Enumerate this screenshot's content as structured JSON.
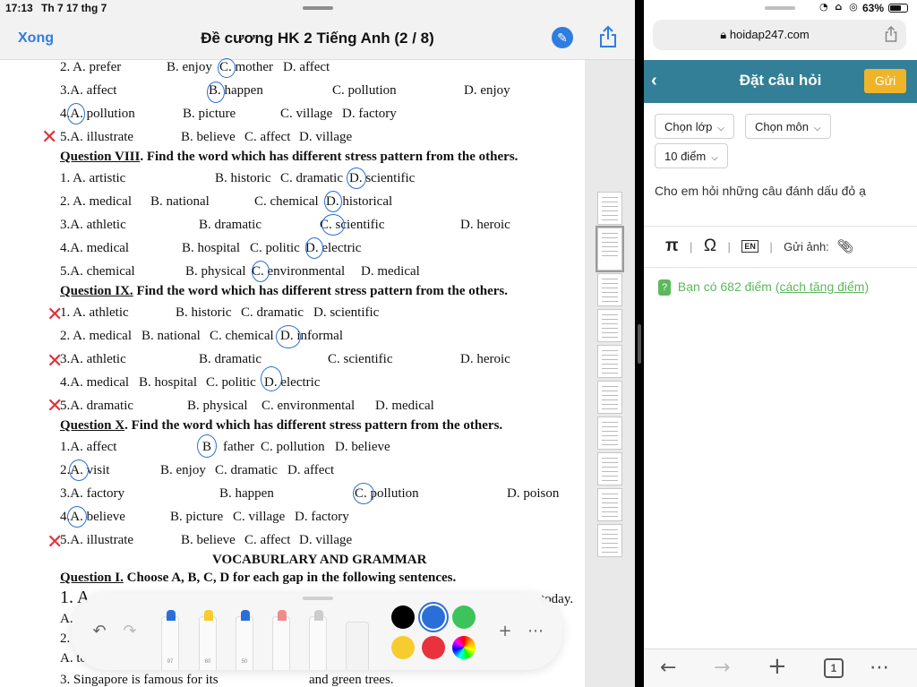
{
  "status": {
    "time": "17:13",
    "date": "Th 7 17 thg 7",
    "battery": "63%",
    "status_icons": "wifi-icon lock-icon location-icon"
  },
  "left_nav": {
    "done_label": "Xong",
    "title": "Đề cương HK 2 Tiếng Anh (2 / 8)",
    "markup_icon": "pen-markup-icon",
    "share_icon": "share-icon"
  },
  "doc": {
    "lines": [
      {
        "parts": [
          "2. A. prefer",
          "B. enjoy",
          "C. mother",
          "D. affect"
        ]
      },
      {
        "parts": [
          "3.A. affect",
          "B. happen",
          "C. pollution",
          "D. enjoy"
        ]
      },
      {
        "parts": [
          "4.A. pollution",
          "B. picture",
          "C. village",
          "D. factory"
        ]
      },
      {
        "parts": [
          "5.A. illustrate",
          "B. believe",
          "C. affect",
          "D. village"
        ]
      },
      {
        "q_label": "Question VIII",
        "q_text": ". Find the word which has different stress pattern from the others."
      },
      {
        "parts": [
          "1. A. artistic",
          "B. historic",
          "C. dramatic",
          "D. scientific"
        ]
      },
      {
        "parts": [
          "2. A. medical",
          "B. national",
          "C. chemical",
          "D. historical"
        ]
      },
      {
        "parts": [
          "3.A. athletic",
          "B. dramatic",
          "C. scientific",
          "D. heroic"
        ]
      },
      {
        "parts": [
          "4.A. medical",
          "B. hospital",
          "C. politic",
          "D. electric"
        ]
      },
      {
        "parts": [
          "5.A. chemical",
          "B. physical",
          "C. environmental",
          "D. medical"
        ]
      },
      {
        "q_label": "Question IX.",
        "q_text": " Find the word which has different stress pattern from the others."
      },
      {
        "parts": [
          "1. A. athletic",
          "B. historic",
          "C. dramatic",
          "D. scientific"
        ]
      },
      {
        "parts": [
          "2. A. medical",
          "B. national",
          "C. chemical",
          "D. informal"
        ]
      },
      {
        "parts": [
          "3.A. athletic",
          "B. dramatic",
          "C. scientific",
          "D. heroic"
        ]
      },
      {
        "parts": [
          "4.A. medical",
          "B. hospital",
          "C. politic",
          "D. electric"
        ]
      },
      {
        "parts": [
          "5.A. dramatic",
          "B. physical",
          "C. environmental",
          "D. medical"
        ]
      },
      {
        "q_label": "Question X",
        "q_text": ". Find the word which has different stress pattern from the others."
      },
      {
        "parts": [
          "1.A. affect",
          "B",
          "father",
          "C. pollution",
          "D. believe"
        ]
      },
      {
        "parts": [
          "2.A. visit",
          "B. enjoy",
          "C. dramatic",
          "D. affect"
        ]
      },
      {
        "parts": [
          "3.A. factory",
          "B. happen",
          "C. pollution",
          "D. poison"
        ]
      },
      {
        "parts": [
          "4.A. believe",
          "B. picture",
          "C. village",
          "D. factory"
        ]
      },
      {
        "parts": [
          "5.A. illustrate",
          "B. believe",
          "C. affect",
          "D. village"
        ]
      },
      {
        "section": "VOCABURLARY AND GRAMMAR"
      },
      {
        "q_label": "Question I.",
        "q_text": " Choose A, B, C, D for each gap in the following sentences."
      },
      {
        "parts": [
          "1. A",
          "today."
        ]
      },
      {
        "parts": [
          "A."
        ]
      },
      {
        "parts": [
          "2."
        ]
      },
      {
        "parts": [
          "A. to"
        ]
      },
      {
        "parts": [
          "3. Singapore is famous for its",
          "and green trees."
        ]
      }
    ]
  },
  "toolbar": {
    "undo_icon": "undo-icon",
    "redo_icon": "redo-icon",
    "tools": [
      {
        "name": "pen",
        "size": "97"
      },
      {
        "name": "highlighter",
        "size": "80"
      },
      {
        "name": "pencil",
        "size": "50"
      },
      {
        "name": "eraser",
        "size": ""
      },
      {
        "name": "lasso",
        "size": ""
      },
      {
        "name": "ruler",
        "size": ""
      }
    ],
    "colors": [
      "#000000",
      "#2a6fd8",
      "#3cc45a",
      "#f6cc2f",
      "#e8323c",
      "rainbow"
    ],
    "selected_color": "#2a6fd8",
    "add_icon": "plus-icon",
    "more_icon": "more-icon"
  },
  "browser": {
    "url": "hoidap247.com",
    "lock_icon": "lock-icon",
    "share_icon": "share-icon"
  },
  "site": {
    "title": "Đặt câu hỏi",
    "back_icon": "chevron-left-icon",
    "send_label": "Gửi",
    "select_class": "Chọn lớp",
    "select_subject": "Chọn môn",
    "select_points": "10 điểm",
    "question_text": "Cho em hỏi những câu đánh dấu đỏ ạ",
    "tools": {
      "pi": "π",
      "omega": "Ω",
      "en": "EN",
      "upload_label": "Gửi ảnh:"
    },
    "points_prefix": "Bạn có 682 điểm",
    "points_link": "(cách tăng điểm)",
    "points_badge": "?"
  },
  "bottombar": {
    "back_icon": "arrow-left-icon",
    "forward_icon": "arrow-right-icon",
    "new_tab_icon": "plus-icon",
    "tabs_count": "1",
    "more_icon": "more-icon"
  }
}
